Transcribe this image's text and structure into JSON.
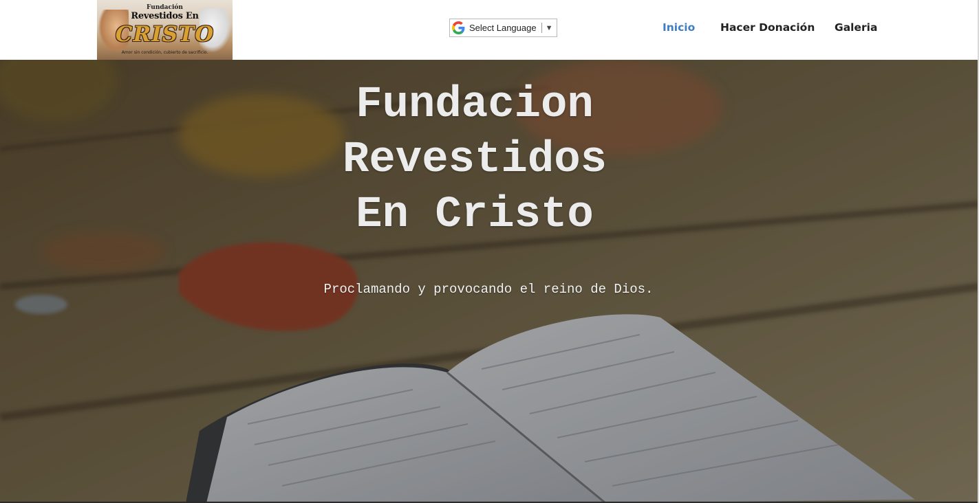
{
  "header": {
    "logo": {
      "line1": "Fundación",
      "line2": "Revestidos En",
      "line3": "CRISTO",
      "tagline": "Amor sin condición, cubierto de sacrificio."
    },
    "translate": {
      "label": "Select Language",
      "icon": "google-icon",
      "arrow": "▼"
    },
    "nav": [
      {
        "label": "Inicio",
        "active": true
      },
      {
        "label": "Hacer Donación",
        "active": false
      },
      {
        "label": "Galeria",
        "active": false
      }
    ]
  },
  "hero": {
    "title": "Fundacion\nRevestidos\n En Cristo",
    "subtitle": "Proclamando y provocando el reino de Dios."
  },
  "colors": {
    "nav_active": "#3f7dc1",
    "nav_text": "#222222",
    "hero_text": "#ececec"
  }
}
